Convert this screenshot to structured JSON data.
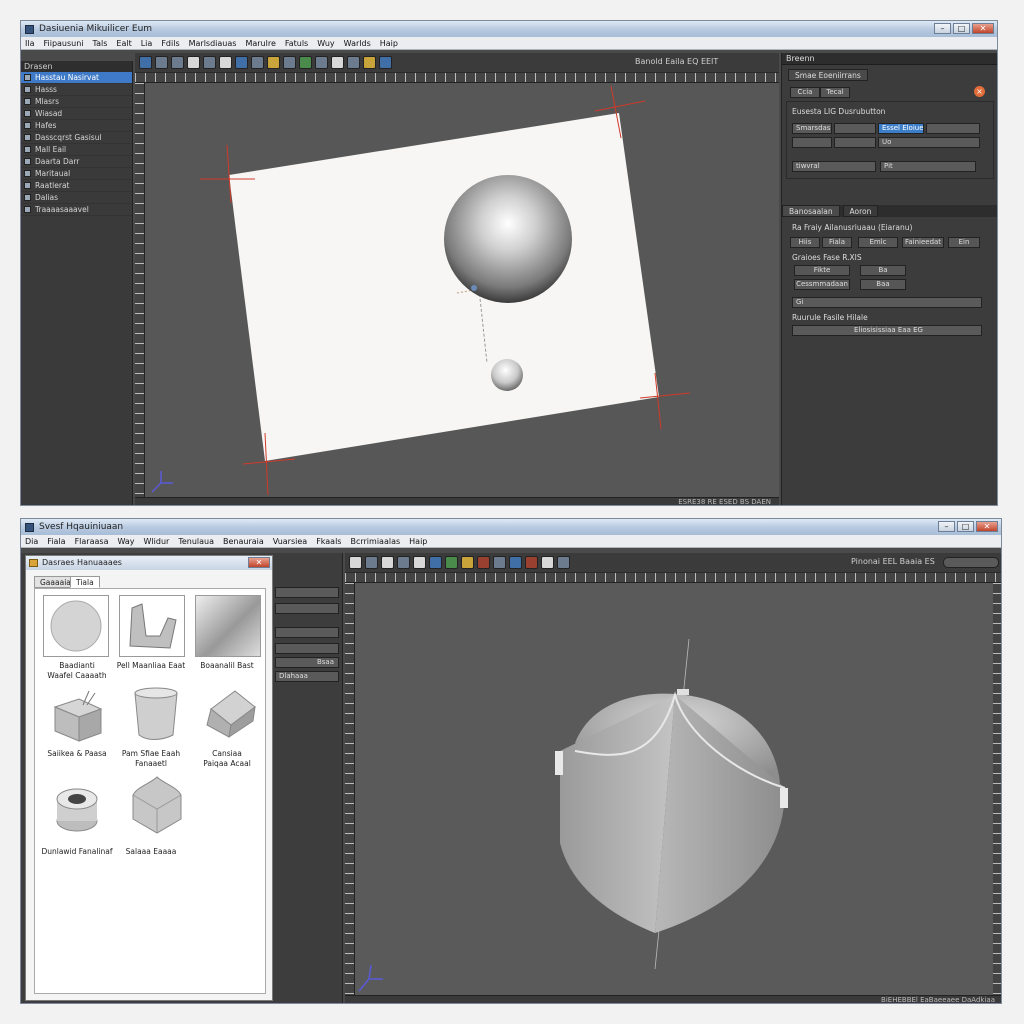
{
  "top_window": {
    "title": "Dasiuenia Mikuilicer Eum",
    "menu": [
      "Ila",
      "Fiipausuni",
      "Tals",
      "Ealt",
      "Lia",
      "Fdils",
      "Marlsdiauas",
      "Marulre",
      "Fatuls",
      "Wuy",
      "Warlds",
      "Haip"
    ],
    "toolbar_status": "Banold Eaila EQ EEIT",
    "left_panel": {
      "header": "Drasen",
      "items": [
        "Hasstau Nasirvat",
        "Hasss",
        "Mlasrs",
        "Wiasad",
        "Hafes",
        "Dasscqrst Gasisul",
        "Mall Eail",
        "Daarta Darr",
        "Maritaual",
        "Raatlerat",
        "Dalias",
        "Traaaasaaavel"
      ]
    },
    "right_panel": {
      "header": "Breenn",
      "tab": "Smae Eoeniirrans",
      "btn1": "Ccia",
      "btn2": "Tecal",
      "section1_title": "Eusesta LIG Dusrubutton",
      "fields": [
        "Smarsdas",
        "Essel Eloiuel",
        "Uo",
        "tiwvral",
        "Pit"
      ],
      "section2_tabs": [
        "Banosaalan",
        "Aoron"
      ],
      "row_text": "Ra Fraiy  Ailanusriuaau (Eiaranu)",
      "buttons": [
        "Hiis",
        "Fiala",
        "Emlc",
        "Fainieedat",
        "Ein"
      ],
      "label_a": "Graioes Fase R.XIS",
      "small": [
        "Fikte",
        "Ba",
        "Cessmmadaan",
        "Baa"
      ],
      "slider_left": "Gi",
      "label_b": "Ruurule Fasile Hilale",
      "dropdown": "Eliosisissiaa Eaa EG"
    },
    "status": "ESRE38 RE  ESED BS DAEN"
  },
  "bottom_window": {
    "title": "Svesf Hqauiniuaan",
    "menu": [
      "Dia",
      "Fiala",
      "Flaraasa",
      "Way",
      "Wlidur",
      "Tenulaua",
      "Benauraia",
      "Vuarsiea",
      "Fkaals",
      "Bcrrimiaalas",
      "Haip"
    ],
    "toolbar_status": "Pinonai EEL Baaia ES",
    "dialog": {
      "title": "Dasraes Hanuaaaes",
      "tabs": [
        "Gaaaaia",
        "Tiala"
      ],
      "items": [
        {
          "label": "Baadianti\nWaafel Caaaath"
        },
        {
          "label": "Pell Maanliaa Eaat"
        },
        {
          "label": "Boaanalil Bast"
        },
        {
          "label": "Saiikea & Paasa"
        },
        {
          "label": "Pam Sfiae Eaah\nFanaaetl"
        },
        {
          "label": "Cansiaa\nPaiqaa Acaal"
        },
        {
          "label": "Dunlawid Fanalinaf"
        },
        {
          "label": "Salaaa Eaaaa"
        }
      ]
    },
    "side_field": "Bsaa",
    "side_field2": "Dlahaaa",
    "status": "BiEHEBBEl  EaBaeeaee  DaAdkiaa"
  }
}
